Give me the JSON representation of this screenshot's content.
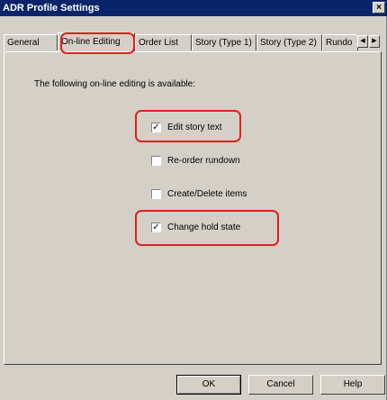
{
  "window": {
    "title": "ADR Profile Settings",
    "close_label": "×"
  },
  "tabs": [
    {
      "label": "General"
    },
    {
      "label": "On-line Editing",
      "active": true
    },
    {
      "label": "Order List"
    },
    {
      "label": "Story (Type 1)"
    },
    {
      "label": "Story (Type 2)"
    },
    {
      "label": "Rundo"
    }
  ],
  "tab_scroll": {
    "left": "◀",
    "right": "▶"
  },
  "panel": {
    "intro": "The following on-line editing is available:",
    "options": [
      {
        "label": "Edit story text",
        "checked": true,
        "mark": "✓"
      },
      {
        "label": "Re-order rundown",
        "checked": false,
        "mark": ""
      },
      {
        "label": "Create/Delete items",
        "checked": false,
        "mark": ""
      },
      {
        "label": "Change hold state",
        "checked": true,
        "mark": "✓"
      }
    ]
  },
  "buttons": {
    "ok": "OK",
    "cancel": "Cancel",
    "help": "Help"
  },
  "colors": {
    "titlebar": "#0a246a",
    "face": "#d4d0c8",
    "highlight": "#e0201c"
  }
}
